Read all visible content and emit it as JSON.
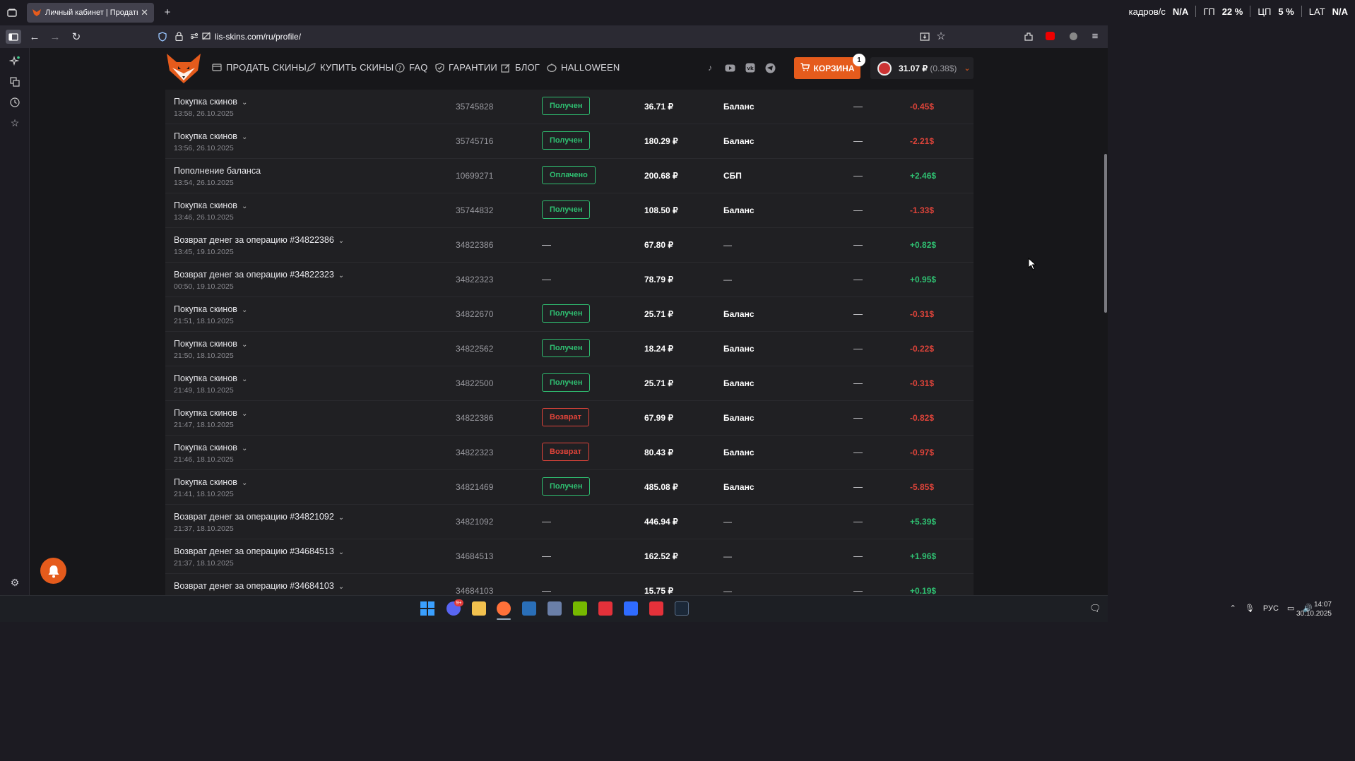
{
  "browser": {
    "tab_title": "Личный кабинет | Продать ск",
    "url": "lis-skins.com/ru/profile/",
    "new_tab": "+"
  },
  "overlay_stats": {
    "fps_label": "кадров/с",
    "fps_value": "N/A",
    "gpu_label": "ГП",
    "gpu_value": "22 %",
    "cpu_label": "ЦП",
    "cpu_value": "5 %",
    "lat_label": "LAT",
    "lat_value": "N/A"
  },
  "site": {
    "nav": [
      {
        "label": "ПРОДАТЬ СКИНЫ",
        "icon": "card-icon"
      },
      {
        "label": "КУПИТЬ СКИНЫ",
        "icon": "rocket-icon"
      },
      {
        "label": "FAQ",
        "icon": "question-icon"
      },
      {
        "label": "ГАРАНТИИ",
        "icon": "shield-icon"
      },
      {
        "label": "БЛОГ",
        "icon": "edit-icon"
      },
      {
        "label": "HALLOWEEN",
        "icon": "pumpkin-icon"
      }
    ],
    "cart_label": "КОРЗИНА",
    "cart_count": "1",
    "balance": "31.07 ₽",
    "balance_usd": "(0.38$)",
    "accent_color": "#e55b1c"
  },
  "transactions": [
    {
      "type": "Покупка скинов",
      "expand": true,
      "date": "13:58, 26.10.2025",
      "id": "35745828",
      "status": "Получен",
      "status_color": "green",
      "sum": "36.71 ₽",
      "method": "Баланс",
      "extra": "—",
      "change": "-0.45$"
    },
    {
      "type": "Покупка скинов",
      "expand": true,
      "date": "13:56, 26.10.2025",
      "id": "35745716",
      "status": "Получен",
      "status_color": "green",
      "sum": "180.29 ₽",
      "method": "Баланс",
      "extra": "—",
      "change": "-2.21$"
    },
    {
      "type": "Пополнение баланса",
      "expand": false,
      "date": "13:54, 26.10.2025",
      "id": "10699271",
      "status": "Оплачено",
      "status_color": "green",
      "sum": "200.68 ₽",
      "method": "СБП",
      "extra": "—",
      "change": "+2.46$"
    },
    {
      "type": "Покупка скинов",
      "expand": true,
      "date": "13:46, 26.10.2025",
      "id": "35744832",
      "status": "Получен",
      "status_color": "green",
      "sum": "108.50 ₽",
      "method": "Баланс",
      "extra": "—",
      "change": "-1.33$"
    },
    {
      "type": "Возврат денег за операцию #34822386",
      "expand": true,
      "date": "13:45, 19.10.2025",
      "id": "34822386",
      "status": "—",
      "status_color": "none",
      "sum": "67.80 ₽",
      "method": "—",
      "extra": "—",
      "change": "+0.82$"
    },
    {
      "type": "Возврат денег за операцию #34822323",
      "expand": true,
      "date": "00:50, 19.10.2025",
      "id": "34822323",
      "status": "—",
      "status_color": "none",
      "sum": "78.79 ₽",
      "method": "—",
      "extra": "—",
      "change": "+0.95$"
    },
    {
      "type": "Покупка скинов",
      "expand": true,
      "date": "21:51, 18.10.2025",
      "id": "34822670",
      "status": "Получен",
      "status_color": "green",
      "sum": "25.71 ₽",
      "method": "Баланс",
      "extra": "—",
      "change": "-0.31$"
    },
    {
      "type": "Покупка скинов",
      "expand": true,
      "date": "21:50, 18.10.2025",
      "id": "34822562",
      "status": "Получен",
      "status_color": "green",
      "sum": "18.24 ₽",
      "method": "Баланс",
      "extra": "—",
      "change": "-0.22$"
    },
    {
      "type": "Покупка скинов",
      "expand": true,
      "date": "21:49, 18.10.2025",
      "id": "34822500",
      "status": "Получен",
      "status_color": "green",
      "sum": "25.71 ₽",
      "method": "Баланс",
      "extra": "—",
      "change": "-0.31$"
    },
    {
      "type": "Покупка скинов",
      "expand": true,
      "date": "21:47, 18.10.2025",
      "id": "34822386",
      "status": "Возврат",
      "status_color": "red",
      "sum": "67.99 ₽",
      "method": "Баланс",
      "extra": "—",
      "change": "-0.82$"
    },
    {
      "type": "Покупка скинов",
      "expand": true,
      "date": "21:46, 18.10.2025",
      "id": "34822323",
      "status": "Возврат",
      "status_color": "red",
      "sum": "80.43 ₽",
      "method": "Баланс",
      "extra": "—",
      "change": "-0.97$"
    },
    {
      "type": "Покупка скинов",
      "expand": true,
      "date": "21:41, 18.10.2025",
      "id": "34821469",
      "status": "Получен",
      "status_color": "green",
      "sum": "485.08 ₽",
      "method": "Баланс",
      "extra": "—",
      "change": "-5.85$"
    },
    {
      "type": "Возврат денег за операцию #34821092",
      "expand": true,
      "date": "21:37, 18.10.2025",
      "id": "34821092",
      "status": "—",
      "status_color": "none",
      "sum": "446.94 ₽",
      "method": "—",
      "extra": "—",
      "change": "+5.39$"
    },
    {
      "type": "Возврат денег за операцию #34684513",
      "expand": true,
      "date": "21:37, 18.10.2025",
      "id": "34684513",
      "status": "—",
      "status_color": "none",
      "sum": "162.52 ₽",
      "method": "—",
      "extra": "—",
      "change": "+1.96$"
    },
    {
      "type": "Возврат денег за операцию #34684103",
      "expand": true,
      "date": "",
      "id": "34684103",
      "status": "—",
      "status_color": "none",
      "sum": "15.75 ₽",
      "method": "—",
      "extra": "—",
      "change": "+0.19$"
    }
  ],
  "taskbar": {
    "lang": "РУС",
    "time": "14:07",
    "date": "30.10.2025",
    "discord_badge": "9+"
  }
}
